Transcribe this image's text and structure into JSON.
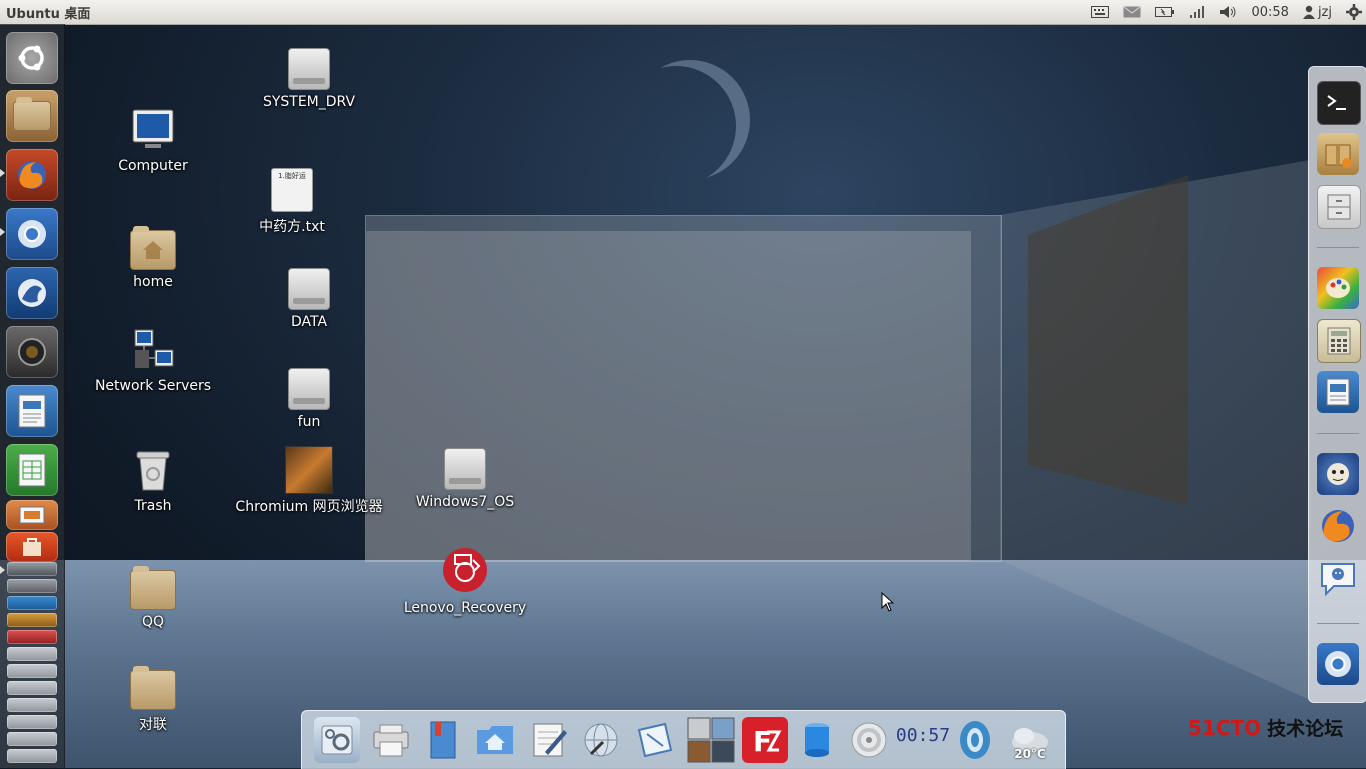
{
  "panel": {
    "title": "Ubuntu 桌面",
    "time": "00:58",
    "user": "jzj"
  },
  "launcher": {
    "items": [
      {
        "name": "ubuntu-dash"
      },
      {
        "name": "files"
      },
      {
        "name": "firefox"
      },
      {
        "name": "chromium"
      },
      {
        "name": "thunderbird"
      },
      {
        "name": "camera"
      },
      {
        "name": "libreoffice-writer"
      },
      {
        "name": "libreoffice-calc"
      },
      {
        "name": "libreoffice-impress"
      },
      {
        "name": "ubuntu-software"
      }
    ]
  },
  "desktop": {
    "icons": [
      {
        "label": "SYSTEM_DRV",
        "kind": "drive"
      },
      {
        "label": "Computer",
        "kind": "computer"
      },
      {
        "label": "中药方.txt",
        "kind": "text-file",
        "preview": "1.脂好运"
      },
      {
        "label": "home",
        "kind": "home-folder"
      },
      {
        "label": "DATA",
        "kind": "drive"
      },
      {
        "label": "Network Servers",
        "kind": "network"
      },
      {
        "label": "fun",
        "kind": "drive"
      },
      {
        "label": "Trash",
        "kind": "trash"
      },
      {
        "label": "Chromium 网页浏览器",
        "kind": "app"
      },
      {
        "label": "Windows7_OS",
        "kind": "drive"
      },
      {
        "label": "Lenovo_Recovery",
        "kind": "recovery"
      },
      {
        "label": "QQ",
        "kind": "folder"
      },
      {
        "label": "对联",
        "kind": "folder"
      }
    ]
  },
  "bottom_dock": {
    "clock": "00:57",
    "temperature": "20°C"
  },
  "watermark": {
    "brand": "51CTO",
    "text": "技术论坛"
  },
  "colors": {
    "panel": "#dcd9d3",
    "launcher": "#282d32",
    "watermark_red": "#d01818"
  }
}
